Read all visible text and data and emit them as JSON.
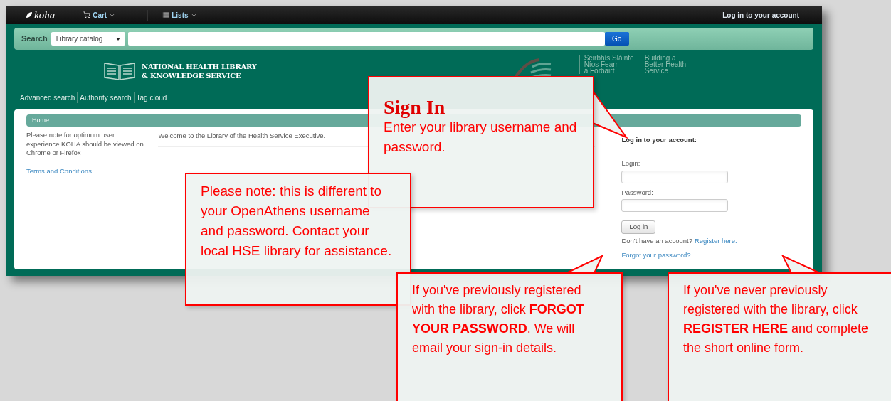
{
  "navbar": {
    "logo": "koha",
    "menus": [
      {
        "label": "Cart",
        "kind": "cart"
      },
      {
        "label": "Lists",
        "kind": "lists"
      }
    ],
    "login_link": "Log in to your account"
  },
  "search": {
    "label": "Search",
    "scope": "Library catalog",
    "button": "Go"
  },
  "header": {
    "library_name": [
      "NATIONAL HEALTH LIBRARY",
      "& KNOWLEDGE SERVICE"
    ],
    "hse_text": [
      "Seirbhís Sláinte",
      "Níos Fearr",
      "á Forbairt"
    ],
    "slogan": [
      "Building a",
      "Better Health",
      "Service"
    ]
  },
  "links": [
    "Advanced search",
    "Authority search",
    "Tag cloud"
  ],
  "breadcrumb": "Home",
  "sidebar": {
    "notice": "Please note for optimum user experience KOHA should be viewed on Chrome or Firefox",
    "link": "Terms and Conditions"
  },
  "welcome": "Welcome to the Library of the Health Service Executive.",
  "login": {
    "title": "Log in to your account:",
    "fields": [
      {
        "label": "Login:"
      },
      {
        "label": "Password:"
      }
    ],
    "button": "Log in",
    "register_prompt": "Don't have an account?",
    "register_link": "Register here.",
    "forgot_link": "Forgot your password?"
  },
  "callouts": [
    {
      "title": "Sign In",
      "text": "Enter your library username and password."
    },
    {
      "text": "Please note: this is different to your OpenAthens username and password. Contact your local HSE library for assistance."
    },
    {
      "text": "If you've previously registered with the library, click **FORGOT YOUR PASSWORD**. We will email your sign-in details."
    },
    {
      "text": "If you've never previously registered with the library, click **REGISTER HERE** and complete the short online form."
    }
  ]
}
